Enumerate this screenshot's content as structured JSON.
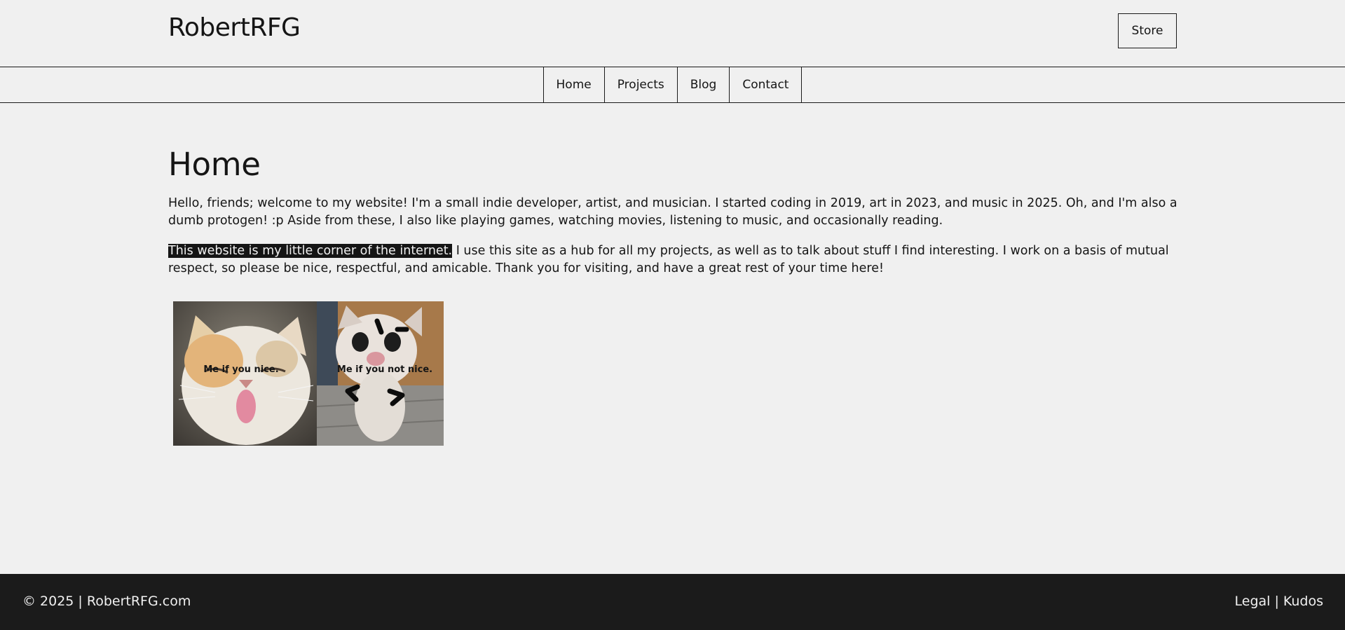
{
  "header": {
    "site_title": "RobertRFG",
    "store_label": "Store"
  },
  "nav": {
    "items": [
      {
        "label": "Home"
      },
      {
        "label": "Projects"
      },
      {
        "label": "Blog"
      },
      {
        "label": "Contact"
      }
    ]
  },
  "main": {
    "page_title": "Home",
    "paragraph1": "Hello, friends; welcome to my website! I'm a small indie developer, artist, and musician. I started coding in 2019, art in 2023, and music in 2025. Oh, and I'm also a dumb protogen! :p Aside from these, I also like playing games, watching movies, listening to music, and occasionally reading.",
    "paragraph2_highlight": "This website is my little corner of the internet.",
    "paragraph2_rest": " I use this site as a hub for all my projects, as well as to talk about stuff I find interesting. I work on a basis of mutual respect, so please be nice, respectful, and amicable. Thank you for visiting, and have a great rest of your time here!",
    "gallery": [
      {
        "caption": "Me if you nice.",
        "icon": "happy-cat-photo"
      },
      {
        "caption": "Me if you not nice.",
        "icon": "angry-kitten-photo"
      }
    ]
  },
  "footer": {
    "copyright": "© 2025 | RobertRFG.com",
    "legal": "Legal",
    "separator": "|",
    "kudos": "Kudos"
  },
  "colors": {
    "background": "#f0f0f0",
    "text": "#151515",
    "footer_bg": "#1b1b1b",
    "footer_text": "#f0f0f0"
  }
}
